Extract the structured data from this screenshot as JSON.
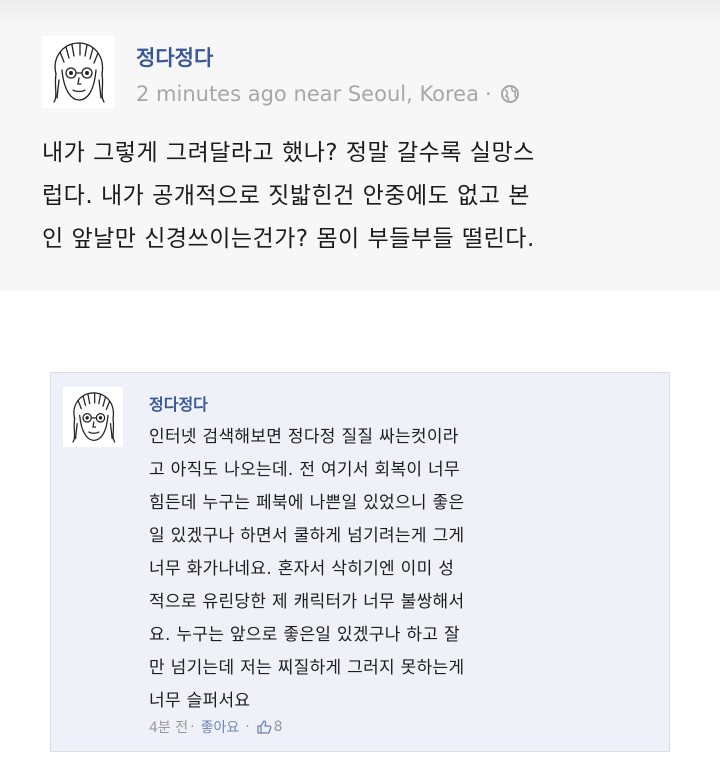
{
  "post": {
    "author": "정다정다",
    "time": "2 minutes ago near Seoul, Korea",
    "separator": "·",
    "lines": [
      "내가 그렇게 그려달라고 했나? 정말 갈수록 실망스",
      "럽다. 내가 공개적으로 짓밟힌건 안중에도 없고 본",
      "인 앞날만 신경쓰이는건가? 몸이 부들부들 떨린다."
    ]
  },
  "comment": {
    "author": "정다정다",
    "lines": [
      "인터넷 검색해보면 정다정 질질 싸는컷이라",
      "고 아직도 나오는데. 전 여기서 회복이 너무",
      "힘든데 누구는 페북에 나쁜일 있었으니 좋은",
      "일 있겠구나 하면서 쿨하게 넘기려는게 그게",
      "너무 화가나네요. 혼자서 삭히기엔 이미 성",
      "적으로 유린당한 제 캐릭터가 너무 불쌍해서",
      "요. 누구는 앞으로 좋은일 있겠구나 하고 잘",
      "만 넘기는데 저는 찌질하게 그러지 못하는게",
      "너무 슬퍼서요"
    ],
    "time": "4분 전",
    "separator": "·",
    "like_label": "좋아요",
    "like_count": "8"
  },
  "icons": {
    "globe": "globe-icon",
    "thumb": "thumbs-up-icon",
    "avatar": "sketch-face-avatar"
  },
  "colors": {
    "name_link": "#3b5998",
    "meta_gray": "#a7a7a7",
    "comment_bg": "#eef1f7"
  }
}
